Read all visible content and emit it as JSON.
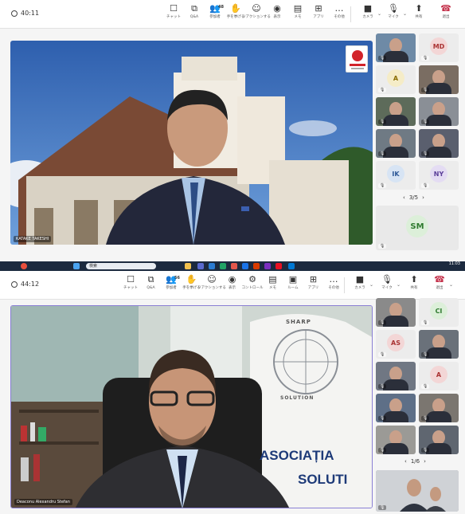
{
  "top": {
    "timer": "40:11",
    "toolbar": [
      {
        "icon": "chat-icon",
        "glyph": "☐",
        "label": "チャット"
      },
      {
        "icon": "qa-icon",
        "glyph": "⧉",
        "label": "Q&A"
      },
      {
        "icon": "people-icon",
        "glyph": "👥",
        "label": "参加者",
        "count": "48"
      },
      {
        "icon": "raise-hand-icon",
        "glyph": "✋",
        "label": "手を挙げる"
      },
      {
        "icon": "reactions-icon",
        "glyph": "☺",
        "label": "リアクションする"
      },
      {
        "icon": "view-icon",
        "glyph": "◉",
        "label": "表示"
      },
      {
        "icon": "notes-icon",
        "glyph": "▤",
        "label": "メモ"
      },
      {
        "icon": "apps-icon",
        "glyph": "⊞",
        "label": "アプリ"
      },
      {
        "icon": "more-icon",
        "glyph": "…",
        "label": "その他"
      }
    ],
    "camera_label": "カメラ",
    "mic_label": "マイク",
    "share_label": "共有",
    "leave_label": "退出",
    "speaker_name": "KATAKE TAKESHI",
    "tiles": [
      {
        "initials": "",
        "video": true,
        "color": "#6e8aa6"
      },
      {
        "initials": "MD",
        "video": false,
        "bg": "#f3d6d6",
        "fg": "#a33"
      },
      {
        "initials": "A",
        "video": false,
        "bg": "#f5ecc7",
        "fg": "#8a6d00"
      },
      {
        "initials": "",
        "video": true,
        "color": "#7a6d62"
      },
      {
        "initials": "",
        "video": true,
        "color": "#5d6b5a"
      },
      {
        "initials": "",
        "video": true,
        "color": "#8a8f96"
      },
      {
        "initials": "",
        "video": true,
        "color": "#6f7a84"
      },
      {
        "initials": "",
        "video": true,
        "color": "#5a5f6e"
      },
      {
        "initials": "IK",
        "video": false,
        "bg": "#d7e4f4",
        "fg": "#2b5797"
      },
      {
        "initials": "NY",
        "video": false,
        "bg": "#e4dcf3",
        "fg": "#5b3f99"
      }
    ],
    "pager": "3/5",
    "big_tile_initials": "SM",
    "taskbar_search": "検索",
    "clock_time": "11:03"
  },
  "bottom": {
    "timer": "44:12",
    "toolbar": [
      {
        "icon": "chat-icon",
        "glyph": "☐",
        "label": "チャット"
      },
      {
        "icon": "qa-icon",
        "glyph": "⧉",
        "label": "Q&A"
      },
      {
        "icon": "people-icon",
        "glyph": "👥",
        "label": "参加者",
        "count": "56"
      },
      {
        "icon": "raise-hand-icon",
        "glyph": "✋",
        "label": "手を挙げる"
      },
      {
        "icon": "reactions-icon",
        "glyph": "☺",
        "label": "リアクションする"
      },
      {
        "icon": "view-icon",
        "glyph": "◉",
        "label": "表示"
      },
      {
        "icon": "controls-icon",
        "glyph": "⚙",
        "label": "コントロール"
      },
      {
        "icon": "notes-icon",
        "glyph": "▤",
        "label": "メモ"
      },
      {
        "icon": "rooms-icon",
        "glyph": "▣",
        "label": "ルーム"
      },
      {
        "icon": "apps-icon",
        "glyph": "⊞",
        "label": "アプリ"
      },
      {
        "icon": "more-icon",
        "glyph": "…",
        "label": "その他"
      }
    ],
    "camera_label": "カメラ",
    "mic_label": "マイク",
    "share_label": "共有",
    "leave_label": "退出",
    "speaker_name": "Deaconu Alexandru Stefan",
    "banner_line1": "ASOCIAȚIA",
    "banner_line2": "SOLUTI",
    "logo_top": "SHARP",
    "logo_bottom": "SOLUTION",
    "tiles": [
      {
        "initials": "",
        "video": true,
        "color": "#8a8a8a"
      },
      {
        "initials": "CI",
        "video": false,
        "bg": "#dcefd9",
        "fg": "#2f7a2f"
      },
      {
        "initials": "AS",
        "video": false,
        "bg": "#f3d6d6",
        "fg": "#a33"
      },
      {
        "initials": "",
        "video": true,
        "color": "#6a717a"
      },
      {
        "initials": "",
        "video": true,
        "color": "#707783"
      },
      {
        "initials": "A",
        "video": false,
        "bg": "#f3d6d6",
        "fg": "#a33"
      },
      {
        "initials": "",
        "video": true,
        "color": "#5e6f87"
      },
      {
        "initials": "",
        "video": true,
        "color": "#7b7670"
      },
      {
        "initials": "",
        "video": true,
        "color": "#9b9a96"
      },
      {
        "initials": "",
        "video": true,
        "color": "#5f6670"
      }
    ],
    "pager": "1/6"
  }
}
